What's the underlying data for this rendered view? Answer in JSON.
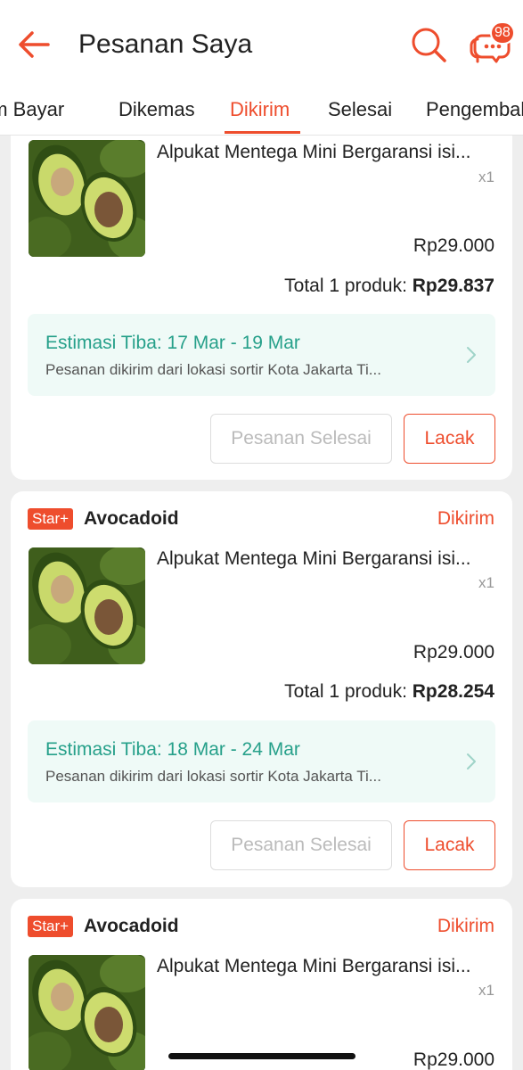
{
  "header": {
    "title": "Pesanan Saya",
    "chat_badge": "98"
  },
  "tabs": [
    "um Bayar",
    "Dikemas",
    "Dikirim",
    "Selesai",
    "Pengembali"
  ],
  "active_tab": "Dikirim",
  "orders": [
    {
      "product_name": "Alpukat Mentega Mini Bergaransi isi...",
      "qty": "x1",
      "price": "Rp29.000",
      "total_label": "Total 1 produk: ",
      "total_value": "Rp29.837",
      "ship_title": "Estimasi Tiba: 17 Mar - 19 Mar",
      "ship_desc": "Pesanan dikirim dari lokasi sortir Kota Jakarta Ti...",
      "btn_done": "Pesanan Selesai",
      "btn_track": "Lacak"
    },
    {
      "badge": "Star+",
      "shop": "Avocadoid",
      "status": "Dikirim",
      "product_name": "Alpukat Mentega Mini Bergaransi isi...",
      "qty": "x1",
      "price": "Rp29.000",
      "total_label": "Total 1 produk: ",
      "total_value": "Rp28.254",
      "ship_title": "Estimasi Tiba: 18 Mar - 24 Mar",
      "ship_desc": "Pesanan dikirim dari lokasi sortir Kota Jakarta Ti...",
      "btn_done": "Pesanan Selesai",
      "btn_track": "Lacak"
    },
    {
      "badge": "Star+",
      "shop": "Avocadoid",
      "status": "Dikirim",
      "product_name": "Alpukat Mentega Mini Bergaransi isi...",
      "qty": "x1",
      "price": "Rp29.000"
    }
  ],
  "colors": {
    "brand": "#ee4d2d",
    "ship_text": "#26a08a",
    "ship_bg": "#effaf7"
  },
  "icons": [
    "back-arrow-icon",
    "search-icon",
    "chat-icon",
    "chevron-right-icon",
    "avocado-product-image"
  ]
}
